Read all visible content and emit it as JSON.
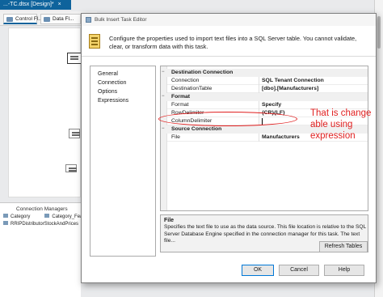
{
  "background": {
    "doc_tab": "...-TC.dtsx [Design]*",
    "doc_tab_close": "×",
    "designer_tabs": [
      "Control Fl...",
      "Data Fl..."
    ],
    "connection_managers": {
      "title": "Connection Managers",
      "items": [
        "Category",
        "Category_Feat",
        "RRIPDistributorStockAndPrices"
      ]
    }
  },
  "dialog": {
    "title": "Bulk Insert Task Editor",
    "header_text": "Configure the properties used to import text files into a SQL Server table. You cannot validate, clear, or transform data with this task.",
    "nav_items": [
      "General",
      "Connection",
      "Options",
      "Expressions"
    ],
    "property_grid": {
      "categories": [
        {
          "label": "Destination Connection",
          "expanded": true,
          "properties": [
            {
              "name": "Connection",
              "value": "SQL Tenant Connection"
            },
            {
              "name": "DestinationTable",
              "value": "[dbo].[Manufacturers]"
            }
          ]
        },
        {
          "label": "Format",
          "expanded": true,
          "properties": [
            {
              "name": "Format",
              "value": "Specify"
            },
            {
              "name": "RowDelimiter",
              "value": "{CR}{LF}"
            },
            {
              "name": "ColumnDelimiter",
              "value": ""
            }
          ]
        },
        {
          "label": "Source Connection",
          "expanded": true,
          "properties": [
            {
              "name": "File",
              "value": "Manufacturers"
            }
          ]
        }
      ],
      "toggle_expanded": "−"
    },
    "description": {
      "title": "File",
      "text": "Specifies the text file to use as the data source. This file location is relative to the SQL Server Database Engine specified in the connection manager for this task. The text file..."
    },
    "buttons": {
      "refresh": "Refresh Tables",
      "ok": "OK",
      "cancel": "Cancel",
      "help": "Help"
    }
  },
  "annotation": {
    "text": "That is change able using expression",
    "color": "#e02020"
  },
  "colors": {
    "accent": "#0e639c",
    "highlight": "#e01e1e"
  }
}
